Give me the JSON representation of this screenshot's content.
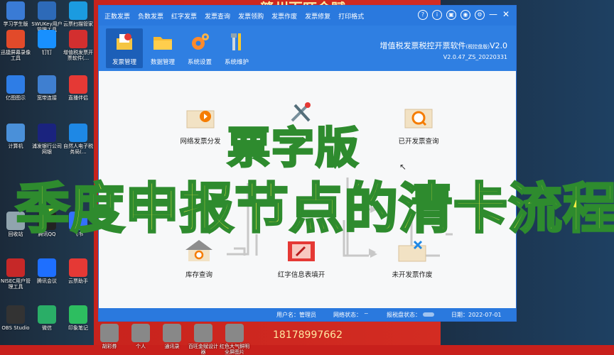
{
  "desktop": {
    "icons": [
      {
        "label": "学习学生版",
        "color": "#3a7bd5"
      },
      {
        "label": "SWUKey用户管理工具",
        "color": "#2d6ab8"
      },
      {
        "label": "云票扫描管家",
        "color": "#1b9be0"
      },
      {
        "label": "迅捷屏幕录像工具",
        "color": "#e24a2a"
      },
      {
        "label": "钉钉",
        "color": "#1890ff"
      },
      {
        "label": "增值税发票开票软件(...",
        "color": "#d32f2f"
      },
      {
        "label": "亿图图示",
        "color": "#2e7de6"
      },
      {
        "label": "宽带连接",
        "color": "#3f7fd0"
      },
      {
        "label": "直播伴侣",
        "color": "#e53935"
      },
      {
        "label": "计算机",
        "color": "#4a90d9"
      },
      {
        "label": "浦发银行公司网银",
        "color": "#1a237e"
      },
      {
        "label": "自然人电子税务局(...",
        "color": "#1e88e5"
      },
      {
        "label": "回收站",
        "color": "#90a4ae"
      },
      {
        "label": "腾讯QQ",
        "color": "#222222"
      },
      {
        "label": "飞书",
        "color": "#3370ff"
      },
      {
        "label": "NISEC用户管理工具",
        "color": "#c62828"
      },
      {
        "label": "腾讯会议",
        "color": "#1e6fff"
      },
      {
        "label": "云票助手",
        "color": "#e53935"
      },
      {
        "label": "OBS Studio",
        "color": "#333333"
      },
      {
        "label": "微信",
        "color": "#2aae67"
      },
      {
        "label": "印象笔记",
        "color": "#2dbe60"
      },
      {
        "label": "胡彩券",
        "color": "#888888"
      },
      {
        "label": "个人",
        "color": "#888888"
      },
      {
        "label": "通讯录",
        "color": "#888888"
      },
      {
        "label": "百旺金赋设计器",
        "color": "#888888"
      },
      {
        "label": "红色大气鲜明全屏图片",
        "color": "#888888"
      }
    ],
    "banner_text": "赣州百旺金赋",
    "phone": "18178997662"
  },
  "window": {
    "menu": [
      "正数发票",
      "负数发票",
      "红字发票",
      "发票查询",
      "发票领购",
      "发票作废",
      "发票修复",
      "打印格式"
    ],
    "toolbar": [
      {
        "label": "发票管理",
        "icon": "invoice-management-icon",
        "active": true
      },
      {
        "label": "数据管理",
        "icon": "folder-icon",
        "active": false
      },
      {
        "label": "系统设置",
        "icon": "gear-icon",
        "active": false
      },
      {
        "label": "系统维护",
        "icon": "tools-icon",
        "active": false
      }
    ],
    "brand_title": "增值税发票税控开票软件",
    "brand_sub": "(税控盘版)",
    "brand_version": "V2.0",
    "brand_build": "V2.0.47_ZS_20220331",
    "functions": {
      "network_dist": "网络发票分发",
      "issued_query": "已开发票查询",
      "stock_query": "库存查询",
      "red_info": "红字信息表填开",
      "void_unissued": "未开发票作废"
    },
    "status": {
      "user_label": "用户名：",
      "user": "管理员",
      "net_label": "网络状态：",
      "disk_label": "报税盘状态：",
      "date_label": "日期：",
      "date": "2022-07-01"
    }
  },
  "overlay": {
    "line1": "票字版",
    "line2": "季度申报节点的清卡流程"
  },
  "colors": {
    "accent": "#2a79de",
    "overlay_fill": "#f8ef45",
    "overlay_stroke": "#2e8b2e"
  }
}
